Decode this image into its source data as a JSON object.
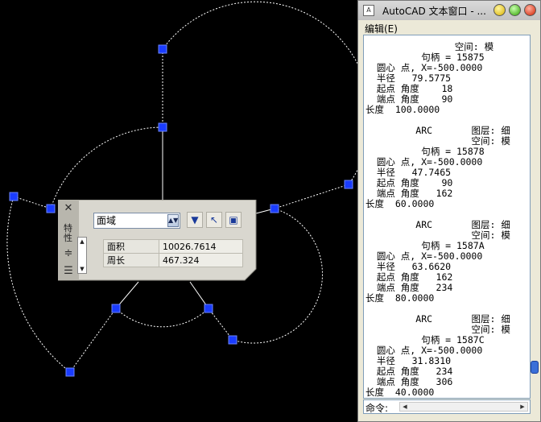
{
  "properties_palette": {
    "object_type": "面域",
    "side_label": "特性",
    "rows": [
      {
        "label": "面积",
        "value": "10026.7614"
      },
      {
        "label": "周长",
        "value": "467.324"
      }
    ]
  },
  "text_window": {
    "title": "AutoCAD 文本窗口 - ...",
    "menu_edit": "编辑(E)",
    "lines": [
      "                空间: 模",
      "          句柄 = 15875",
      "  圆心 点, X=-500.0000",
      "  半径   79.5775",
      "  起点 角度    18",
      "  端点 角度    90",
      "长度  100.0000",
      "",
      "         ARC       图层: 细",
      "                   空间: 模",
      "          句柄 = 15878",
      "  圆心 点, X=-500.0000",
      "  半径   47.7465",
      "  起点 角度    90",
      "  端点 角度   162",
      "长度  60.0000",
      "",
      "         ARC       图层: 细",
      "                   空间: 模",
      "          句柄 = 1587A",
      "  圆心 点, X=-500.0000",
      "  半径   63.6620",
      "  起点 角度   162",
      "  端点 角度   234",
      "长度  80.0000",
      "",
      "         ARC       图层: 细",
      "                   空间: 模",
      "          句柄 = 1587C",
      "  圆心 点, X=-500.0000",
      "  半径   31.8310",
      "  起点 角度   234",
      "  端点 角度   306",
      "长度  40.0000",
      "长度"
    ],
    "command_label": "命令:"
  }
}
